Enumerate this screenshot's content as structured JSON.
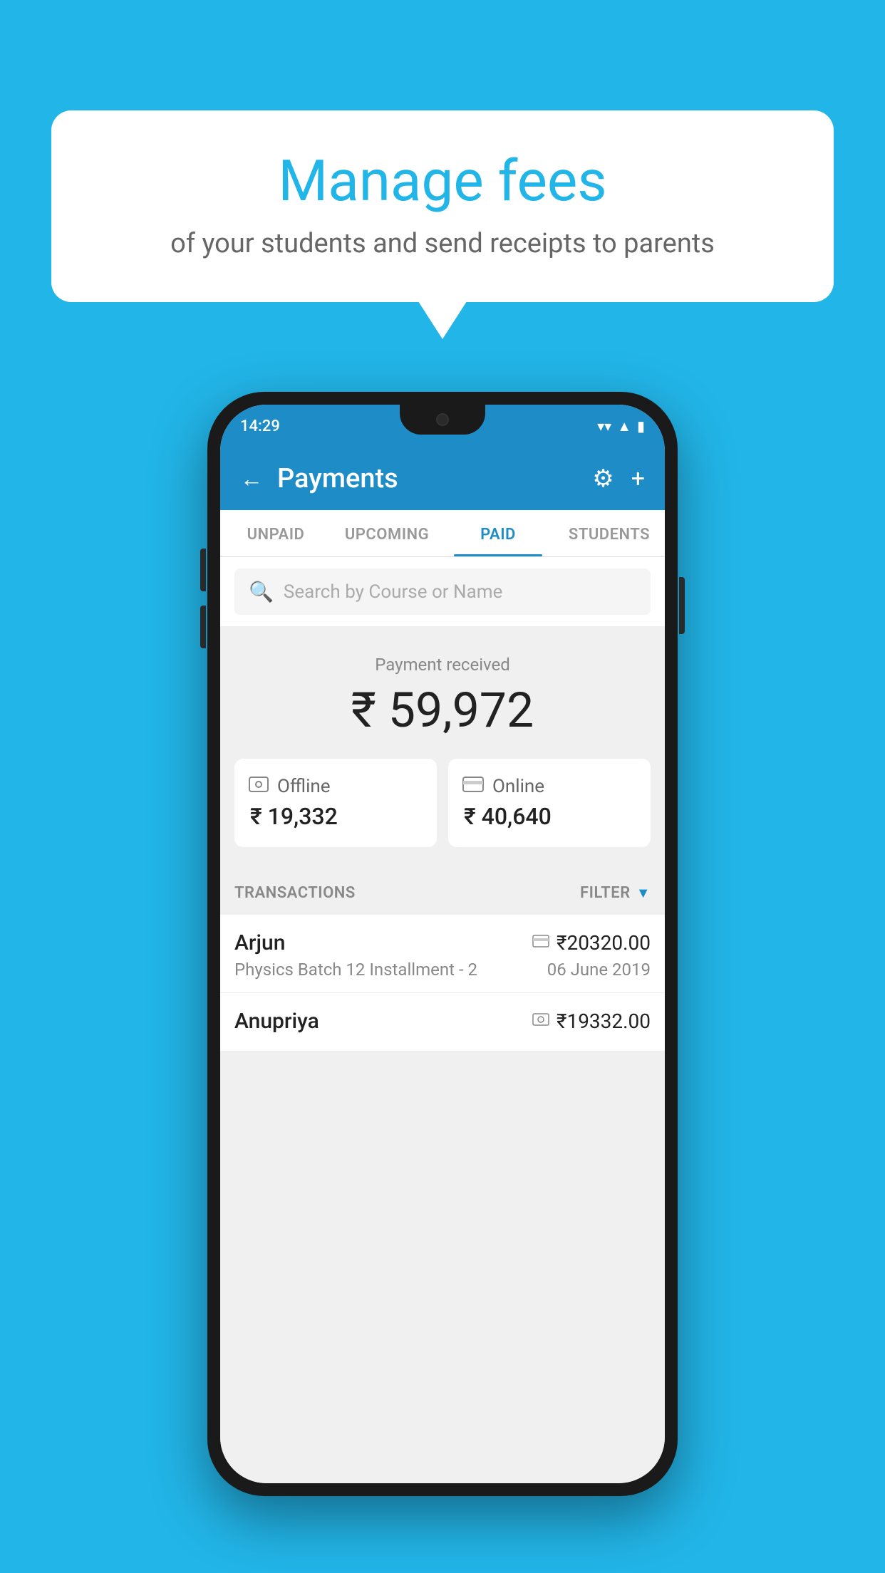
{
  "background_color": "#22b5e8",
  "bubble": {
    "title": "Manage fees",
    "subtitle": "of your students and send receipts to parents"
  },
  "phone": {
    "status_bar": {
      "time": "14:29",
      "icons": [
        "wifi",
        "signal",
        "battery"
      ]
    },
    "header": {
      "title": "Payments",
      "back_label": "←",
      "gear_label": "⚙",
      "plus_label": "+"
    },
    "tabs": [
      {
        "label": "UNPAID",
        "active": false
      },
      {
        "label": "UPCOMING",
        "active": false
      },
      {
        "label": "PAID",
        "active": true
      },
      {
        "label": "STUDENTS",
        "active": false
      }
    ],
    "search": {
      "placeholder": "Search by Course or Name"
    },
    "payment_summary": {
      "label": "Payment received",
      "amount": "₹ 59,972",
      "cards": [
        {
          "icon": "offline",
          "label": "Offline",
          "amount": "₹ 19,332"
        },
        {
          "icon": "online",
          "label": "Online",
          "amount": "₹ 40,640"
        }
      ]
    },
    "transactions": {
      "header_label": "TRANSACTIONS",
      "filter_label": "FILTER",
      "rows": [
        {
          "name": "Arjun",
          "course": "Physics Batch 12 Installment - 2",
          "amount": "₹20320.00",
          "date": "06 June 2019",
          "icon": "card"
        },
        {
          "name": "Anupriya",
          "course": "",
          "amount": "₹19332.00",
          "date": "",
          "icon": "cash"
        }
      ]
    }
  }
}
